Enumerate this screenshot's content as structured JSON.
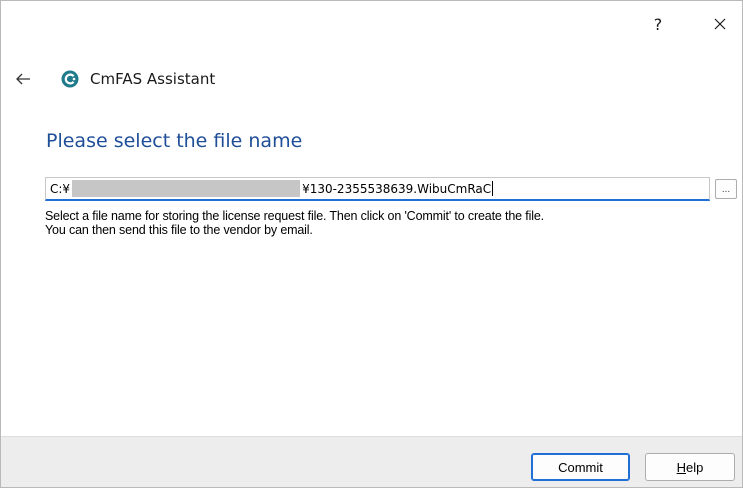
{
  "window": {
    "help_glyph": "?",
    "close_icon": "close-icon"
  },
  "nav": {
    "back_icon": "back-arrow-icon",
    "app_icon": "cmfas-logo-icon",
    "app_name": "CmFAS Assistant"
  },
  "page": {
    "title": "Please select the file name"
  },
  "file": {
    "path_prefix": "C:¥",
    "path_suffix": "¥130-2355538639.WibuCmRaC",
    "browse_label": "..."
  },
  "instructions": {
    "line1": "Select a file name for storing the license request file. Then click on 'Commit' to create the file.",
    "line2": "You can then send this file to the vendor by email."
  },
  "buttons": {
    "commit_label": "Commit",
    "help_accel": "H",
    "help_rest": "elp"
  },
  "colors": {
    "title_blue": "#1f4e99",
    "focus_blue": "#1f6fd6",
    "footer_bg": "#ededed",
    "logo_teal": "#1f7a8c"
  }
}
